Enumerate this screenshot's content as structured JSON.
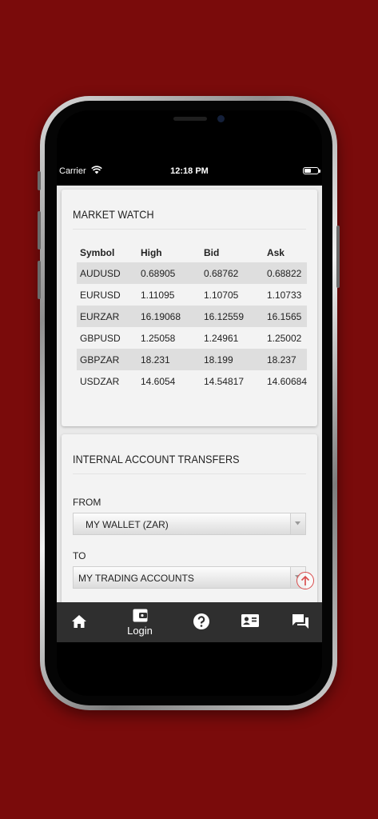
{
  "status_bar": {
    "carrier": "Carrier",
    "time": "12:18 PM"
  },
  "market_watch": {
    "title": "MARKET WATCH",
    "columns": [
      "Symbol",
      "High",
      "Bid",
      "Ask"
    ],
    "rows": [
      [
        "AUDUSD",
        "0.68905",
        "0.68762",
        "0.68822"
      ],
      [
        "EURUSD",
        "1.11095",
        "1.10705",
        "1.10733"
      ],
      [
        "EURZAR",
        "16.19068",
        "16.12559",
        "16.1565"
      ],
      [
        "GBPUSD",
        "1.25058",
        "1.24961",
        "1.25002"
      ],
      [
        "GBPZAR",
        "18.231",
        "18.199",
        "18.237"
      ],
      [
        "USDZAR",
        "14.6054",
        "14.54817",
        "14.60684"
      ]
    ]
  },
  "transfers": {
    "title": "INTERNAL ACCOUNT TRANSFERS",
    "from_label": "FROM",
    "from_value": "MY WALLET (ZAR)",
    "to_label": "TO",
    "to_value": "MY TRADING ACCOUNTS"
  },
  "bottom_nav": {
    "items": [
      {
        "icon": "home-icon",
        "label": ""
      },
      {
        "icon": "wallet-icon",
        "label": "Login"
      },
      {
        "icon": "help-icon",
        "label": ""
      },
      {
        "icon": "contact-card-icon",
        "label": ""
      },
      {
        "icon": "chat-icon",
        "label": ""
      }
    ]
  },
  "colors": {
    "background": "#7a0b0b",
    "nav_bar": "#2f2f2f",
    "accent": "#d94a4a"
  }
}
